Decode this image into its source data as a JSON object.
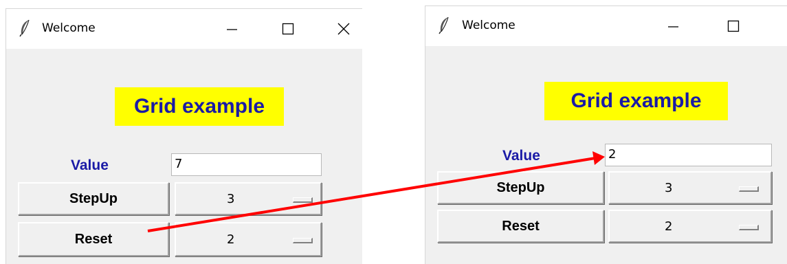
{
  "left_window": {
    "title": "Welcome",
    "heading": "Grid example",
    "value_label": "Value",
    "value": "7",
    "stepup_label": "StepUp",
    "stepup_option": "3",
    "reset_label": "Reset",
    "reset_option": "2"
  },
  "right_window": {
    "title": "Welcome",
    "heading": "Grid example",
    "value_label": "Value",
    "value": "2",
    "stepup_label": "StepUp",
    "stepup_option": "3",
    "reset_label": "Reset",
    "reset_option": "2"
  },
  "colors": {
    "heading_bg": "#ffff00",
    "heading_text": "#1a1aa6",
    "window_bg": "#f0f0f0",
    "arrow": "#ff0000"
  },
  "icons": {
    "app": "feather-icon",
    "minimize": "minimize-icon",
    "maximize": "maximize-icon",
    "close": "close-icon",
    "annotation": "red-arrow"
  }
}
